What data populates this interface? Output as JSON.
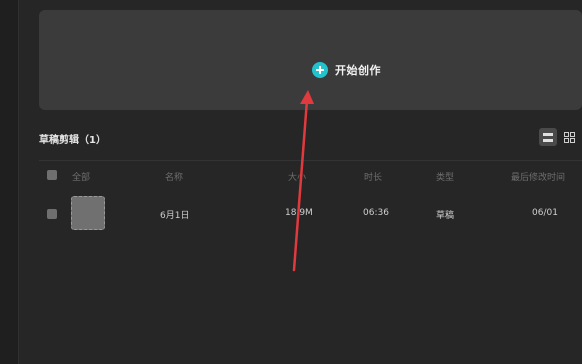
{
  "create": {
    "label": "开始创作",
    "icon": "plus-circle-icon",
    "accent": "#22c3cf"
  },
  "drafts": {
    "title": "草稿剪辑（1）",
    "view_modes": [
      "list-view-icon",
      "grid-view-icon"
    ],
    "columns": {
      "select_all": "全部",
      "name": "名称",
      "size": "大小",
      "duration": "时长",
      "type": "类型",
      "modified": "最后修改时间"
    },
    "rows": [
      {
        "name": "6月1日",
        "size": "18.9M",
        "duration": "06:36",
        "type": "草稿",
        "modified": "06/01"
      }
    ]
  },
  "annotation": {
    "color": "#e03a3e"
  }
}
